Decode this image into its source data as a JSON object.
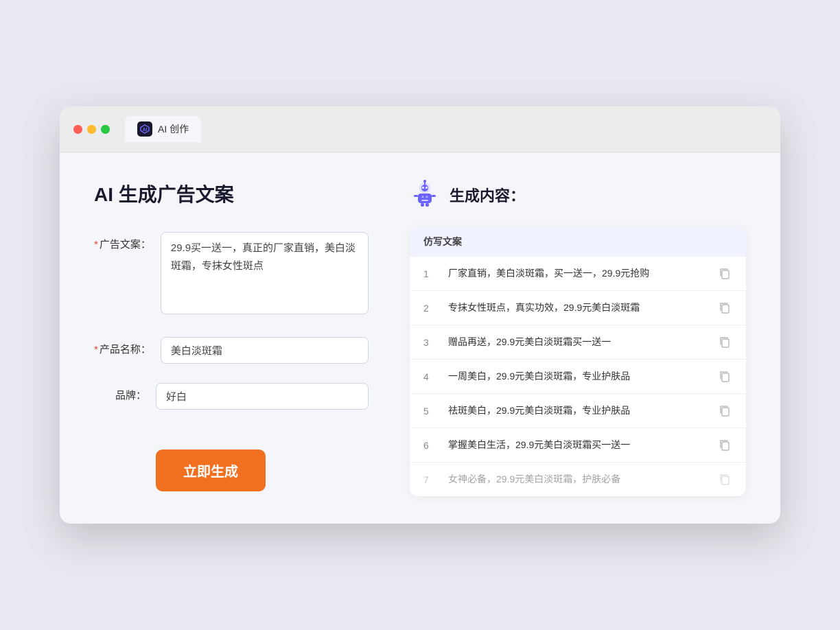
{
  "browser": {
    "tab_label": "AI 创作"
  },
  "page": {
    "title": "AI 生成广告文案"
  },
  "form": {
    "ad_copy_label": "广告文案：",
    "ad_copy_required": "*",
    "ad_copy_value": "29.9买一送一，真正的厂家直销，美白淡斑霜，专抹女性斑点",
    "product_name_label": "产品名称：",
    "product_name_required": "*",
    "product_name_value": "美白淡斑霜",
    "brand_label": "品牌：",
    "brand_value": "好白",
    "generate_btn": "立即生成"
  },
  "result": {
    "header_title": "生成内容：",
    "table_header": "仿写文案",
    "items": [
      {
        "num": "1",
        "text": "厂家直销，美白淡斑霜，买一送一，29.9元抢购",
        "dimmed": false
      },
      {
        "num": "2",
        "text": "专抹女性斑点，真实功效，29.9元美白淡斑霜",
        "dimmed": false
      },
      {
        "num": "3",
        "text": "赠品再送，29.9元美白淡斑霜买一送一",
        "dimmed": false
      },
      {
        "num": "4",
        "text": "一周美白，29.9元美白淡斑霜，专业护肤品",
        "dimmed": false
      },
      {
        "num": "5",
        "text": "祛斑美白，29.9元美白淡斑霜，专业护肤品",
        "dimmed": false
      },
      {
        "num": "6",
        "text": "掌握美白生活，29.9元美白淡斑霜买一送一",
        "dimmed": false
      },
      {
        "num": "7",
        "text": "女神必备，29.9元美白淡斑霜，护肤必备",
        "dimmed": true
      }
    ]
  }
}
